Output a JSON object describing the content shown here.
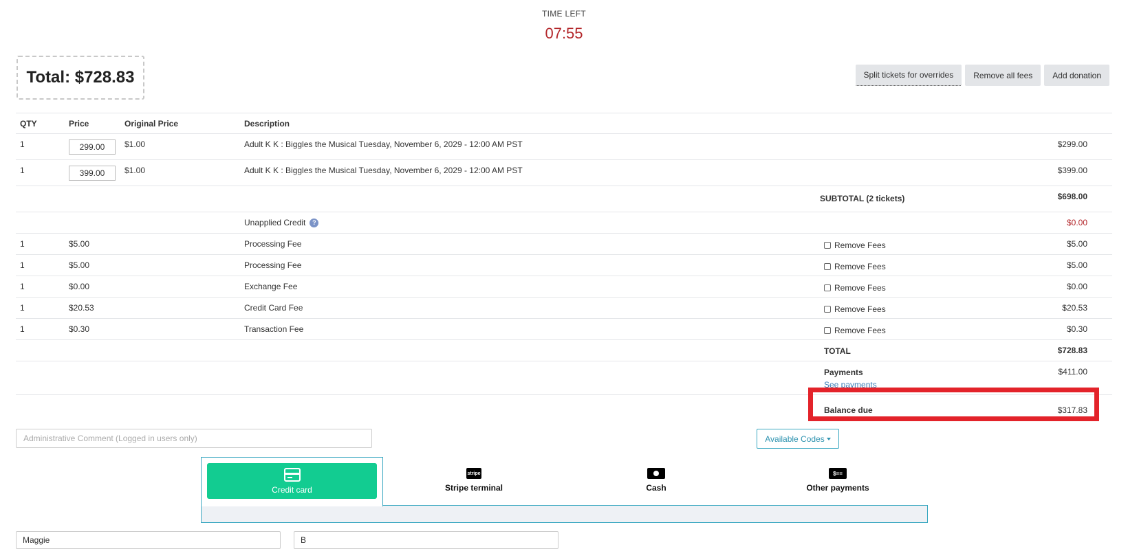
{
  "timer": {
    "label": "TIME LEFT",
    "value": "07:55"
  },
  "header": {
    "total_label": "Total: $728.83"
  },
  "actions": {
    "split": "Split tickets for overrides",
    "remove_fees": "Remove all fees",
    "add_donation": "Add donation"
  },
  "table": {
    "headers": {
      "qty": "QTY",
      "price": "Price",
      "original_price": "Original Price",
      "description": "Description"
    },
    "items": [
      {
        "qty": "1",
        "price": "299.00",
        "original_price": "$1.00",
        "description": "Adult K K : Biggles the Musical Tuesday, November 6, 2029 - 12:00 AM PST",
        "amount": "$299.00"
      },
      {
        "qty": "1",
        "price": "399.00",
        "original_price": "$1.00",
        "description": "Adult K K : Biggles the Musical Tuesday, November 6, 2029 - 12:00 AM PST",
        "amount": "$399.00"
      }
    ],
    "subtotal": {
      "label": "SUBTOTAL (2 tickets)",
      "amount": "$698.00"
    },
    "credit": {
      "label": "Unapplied Credit",
      "help": "?",
      "amount": "$0.00"
    },
    "remove_fees_label": "Remove Fees",
    "fees": [
      {
        "qty": "1",
        "price": "$5.00",
        "description": "Processing Fee",
        "amount": "$5.00"
      },
      {
        "qty": "1",
        "price": "$5.00",
        "description": "Processing Fee",
        "amount": "$5.00"
      },
      {
        "qty": "1",
        "price": "$0.00",
        "description": "Exchange Fee",
        "amount": "$0.00"
      },
      {
        "qty": "1",
        "price": "$20.53",
        "description": "Credit Card Fee",
        "amount": "$20.53"
      },
      {
        "qty": "1",
        "price": "$0.30",
        "description": "Transaction Fee",
        "amount": "$0.30"
      }
    ],
    "total": {
      "label": "TOTAL",
      "amount": "$728.83"
    },
    "payments": {
      "label": "Payments",
      "link": "See payments",
      "amount": "$411.00"
    },
    "balance": {
      "label": "Balance due",
      "amount": "$317.83"
    }
  },
  "comment": {
    "placeholder": "Administrative Comment (Logged in users only)"
  },
  "codes": {
    "label": "Available Codes"
  },
  "payment_tabs": {
    "credit": "Credit card",
    "stripe": "Stripe terminal",
    "stripe_icon_text": "stripe",
    "cash": "Cash",
    "other": "Other payments",
    "other_icon_text": "$=="
  },
  "billing": {
    "first_name": "Maggie",
    "last_name": "B"
  },
  "colors": {
    "accent_green": "#12cc91",
    "timer_red": "#b3262a",
    "highlight_red": "#e3232a",
    "link_blue": "#3b7fb8"
  }
}
